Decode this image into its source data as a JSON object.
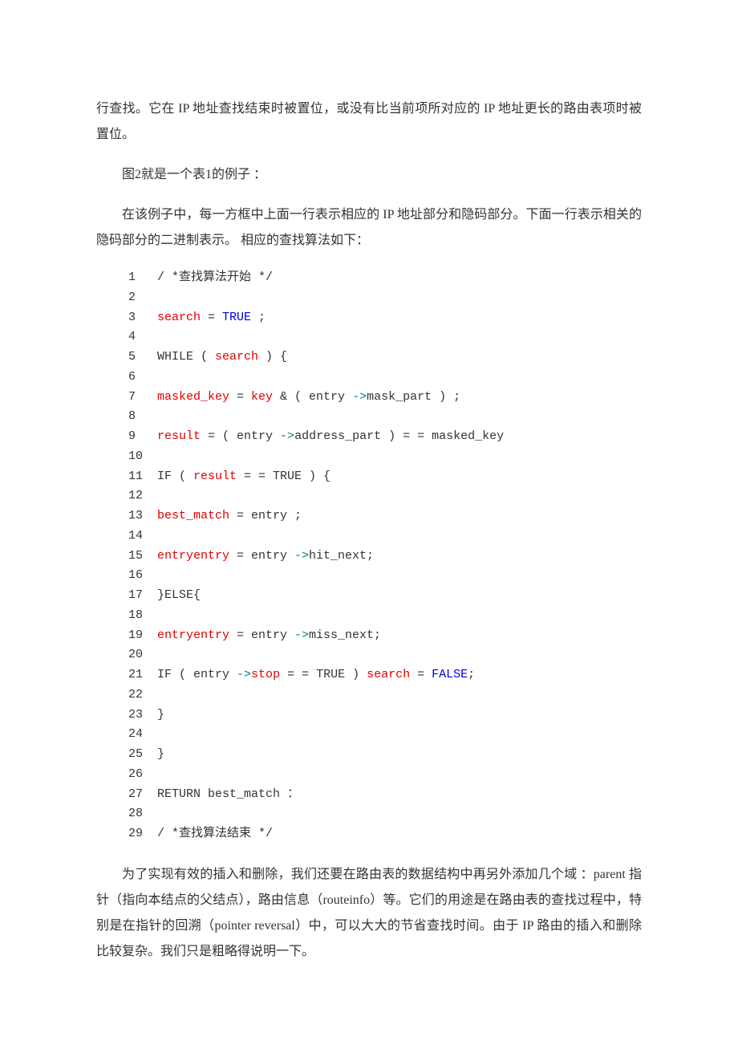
{
  "p1": "行查找。它在 IP 地址查找结束时被置位，或没有比当前项所对应的 IP 地址更长的路由表项时被置位。",
  "p2": "图2就是一个表1的例子 ：",
  "p3": "在该例子中，每一方框中上面一行表示相应的 IP 地址部分和隐码部分。下面一行表示相关的隐码部分的二进制表示。 相应的查找算法如下：",
  "code": {
    "l1": {
      "n": "1",
      "c": "/ *查找算法开始 */"
    },
    "l2": {
      "n": "2",
      "c": ""
    },
    "l3": {
      "n": "3",
      "t1": "search",
      "t2": " = ",
      "t3": "TRUE",
      "t4": " ;"
    },
    "l4": {
      "n": "4",
      "c": ""
    },
    "l5": {
      "n": "5",
      "t1": "WHILE ( ",
      "t2": "search",
      "t3": " ) {"
    },
    "l6": {
      "n": "6",
      "c": ""
    },
    "l7": {
      "n": "7",
      "t1": "masked_key",
      "t2": " = ",
      "t3": "key",
      "t4": " & ( entry ",
      "t5": "->",
      "t6": "mask_part ) ;"
    },
    "l8": {
      "n": "8",
      "c": ""
    },
    "l9": {
      "n": "9",
      "t1": "result",
      "t2": " = ( entry ",
      "t3": "->",
      "t4": "address_part ) = = masked_key"
    },
    "l10": {
      "n": "10",
      "c": ""
    },
    "l11": {
      "n": "11",
      "t1": "IF ( ",
      "t2": "result",
      "t3": " = = TRUE ) {"
    },
    "l12": {
      "n": "12",
      "c": ""
    },
    "l13": {
      "n": "13",
      "t1": "best_match",
      "t2": " = entry ;"
    },
    "l14": {
      "n": "14",
      "c": ""
    },
    "l15": {
      "n": "15",
      "t1": "entryentry",
      "t2": " = entry ",
      "t3": "->",
      "t4": "hit_next;"
    },
    "l16": {
      "n": "16",
      "c": ""
    },
    "l17": {
      "n": "17",
      "c": "}ELSE{"
    },
    "l18": {
      "n": "18",
      "c": ""
    },
    "l19": {
      "n": "19",
      "t1": "entryentry",
      "t2": " = entry ",
      "t3": "->",
      "t4": "miss_next;"
    },
    "l20": {
      "n": "20",
      "c": ""
    },
    "l21": {
      "n": "21",
      "t1": "IF ( entry ",
      "t2": "->",
      "t3": "stop",
      "t4": " = = TRUE ) ",
      "t5": "search",
      "t6": " = ",
      "t7": "FALSE",
      "t8": ";"
    },
    "l22": {
      "n": "22",
      "c": ""
    },
    "l23": {
      "n": "23",
      "c": "}"
    },
    "l24": {
      "n": "24",
      "c": ""
    },
    "l25": {
      "n": "25",
      "c": "}"
    },
    "l26": {
      "n": "26",
      "c": ""
    },
    "l27": {
      "n": "27",
      "c": "RETURN best_match ："
    },
    "l28": {
      "n": "28",
      "c": ""
    },
    "l29": {
      "n": "29",
      "c": "/ *查找算法结束 */"
    }
  },
  "p4": "为了实现有效的插入和删除，我们还要在路由表的数据结构中再另外添加几个域 ：parent 指针（指向本结点的父结点），路由信息（routeinfo）等。它们的用途是在路由表的查找过程中，特别是在指针的回溯（pointer reversal）中，可以大大的节省查找时间。由于 IP 路由的插入和删除比较复杂。我们只是粗略得说明一下。"
}
